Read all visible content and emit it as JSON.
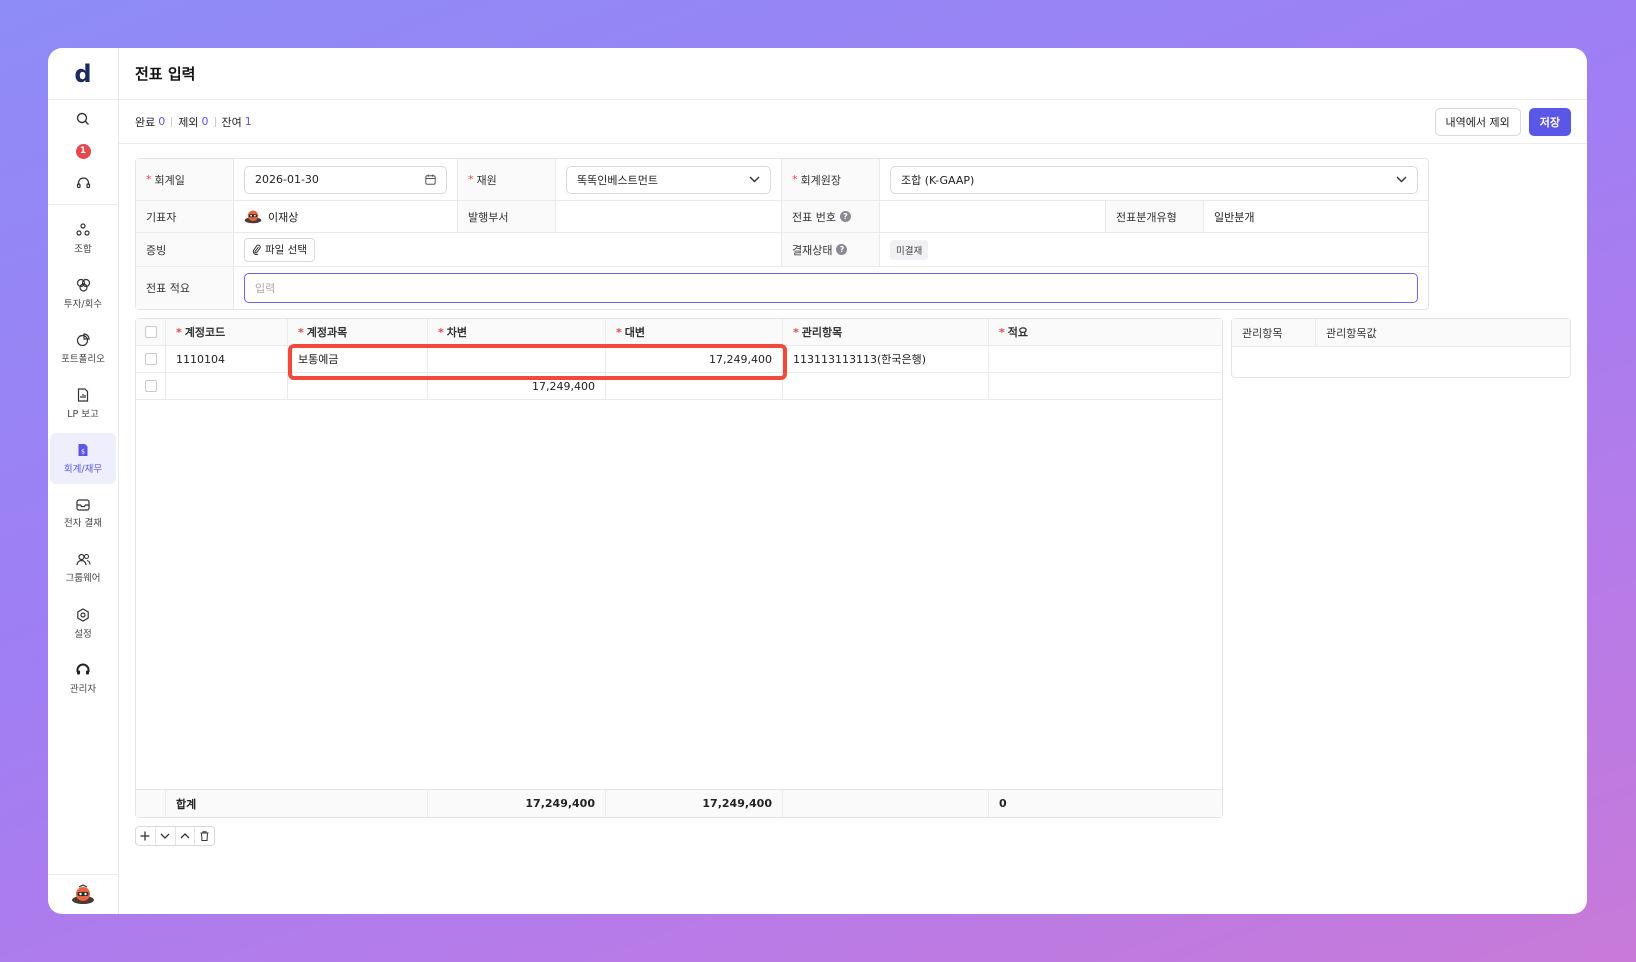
{
  "app": {
    "logo": "d"
  },
  "sidebar": {
    "notification_count": "1",
    "items": [
      {
        "label": "조합",
        "icon": "association-icon"
      },
      {
        "label": "투자/회수",
        "icon": "investment-icon"
      },
      {
        "label": "포트폴리오",
        "icon": "portfolio-icon"
      },
      {
        "label": "LP 보고",
        "icon": "report-icon"
      },
      {
        "label": "회계/재무",
        "icon": "accounting-icon"
      },
      {
        "label": "전자 결재",
        "icon": "approval-icon"
      },
      {
        "label": "그룹웨어",
        "icon": "groupware-icon"
      },
      {
        "label": "설정",
        "icon": "settings-icon"
      },
      {
        "label": "관리자",
        "icon": "admin-icon"
      }
    ]
  },
  "page": {
    "title": "전표 입력"
  },
  "toolbar": {
    "complete_label": "완료",
    "complete_count": "0",
    "exclude_label": "제외",
    "exclude_count": "0",
    "remain_label": "잔여",
    "remain_count": "1",
    "exclude_button": "내역에서 제외",
    "save_button": "저장"
  },
  "form": {
    "date_label": "회계일",
    "date_value": "2026-01-30",
    "fund_label": "재원",
    "fund_value": "똑똑인베스트먼트",
    "ledger_label": "회계원장",
    "ledger_value": "조합 (K-GAAP)",
    "writer_label": "기표자",
    "writer_value": "이재상",
    "dept_label": "발행부서",
    "dept_value": "",
    "voucher_no_label": "전표 번호",
    "voucher_no_value": "",
    "voucher_type_label": "전표분개유형",
    "voucher_type_value": "일반분개",
    "evidence_label": "증빙",
    "file_button": "파일 선택",
    "approval_label": "결재상태",
    "approval_value": "미결재",
    "memo_label": "전표 적요",
    "memo_placeholder": "입력"
  },
  "journal": {
    "headers": {
      "code": "계정코드",
      "name": "계정과목",
      "debit": "차변",
      "credit": "대변",
      "mgmt": "관리항목",
      "memo": "적요"
    },
    "rows": [
      {
        "code": "1110104",
        "name": "보통예금",
        "debit": "",
        "credit": "17,249,400",
        "mgmt": "113113113113(한국은행)",
        "memo": ""
      },
      {
        "code": "",
        "name": "",
        "debit": "17,249,400",
        "credit": "",
        "mgmt": "",
        "memo": ""
      }
    ],
    "footer": {
      "label": "합계",
      "debit_total": "17,249,400",
      "credit_total": "17,249,400",
      "memo_total": "0"
    }
  },
  "mgmt_panel": {
    "item_header": "관리항목",
    "value_header": "관리항목값"
  },
  "colors": {
    "accent": "#5b57e6",
    "highlight": "#f04a3d",
    "badge": "#e5484d"
  }
}
